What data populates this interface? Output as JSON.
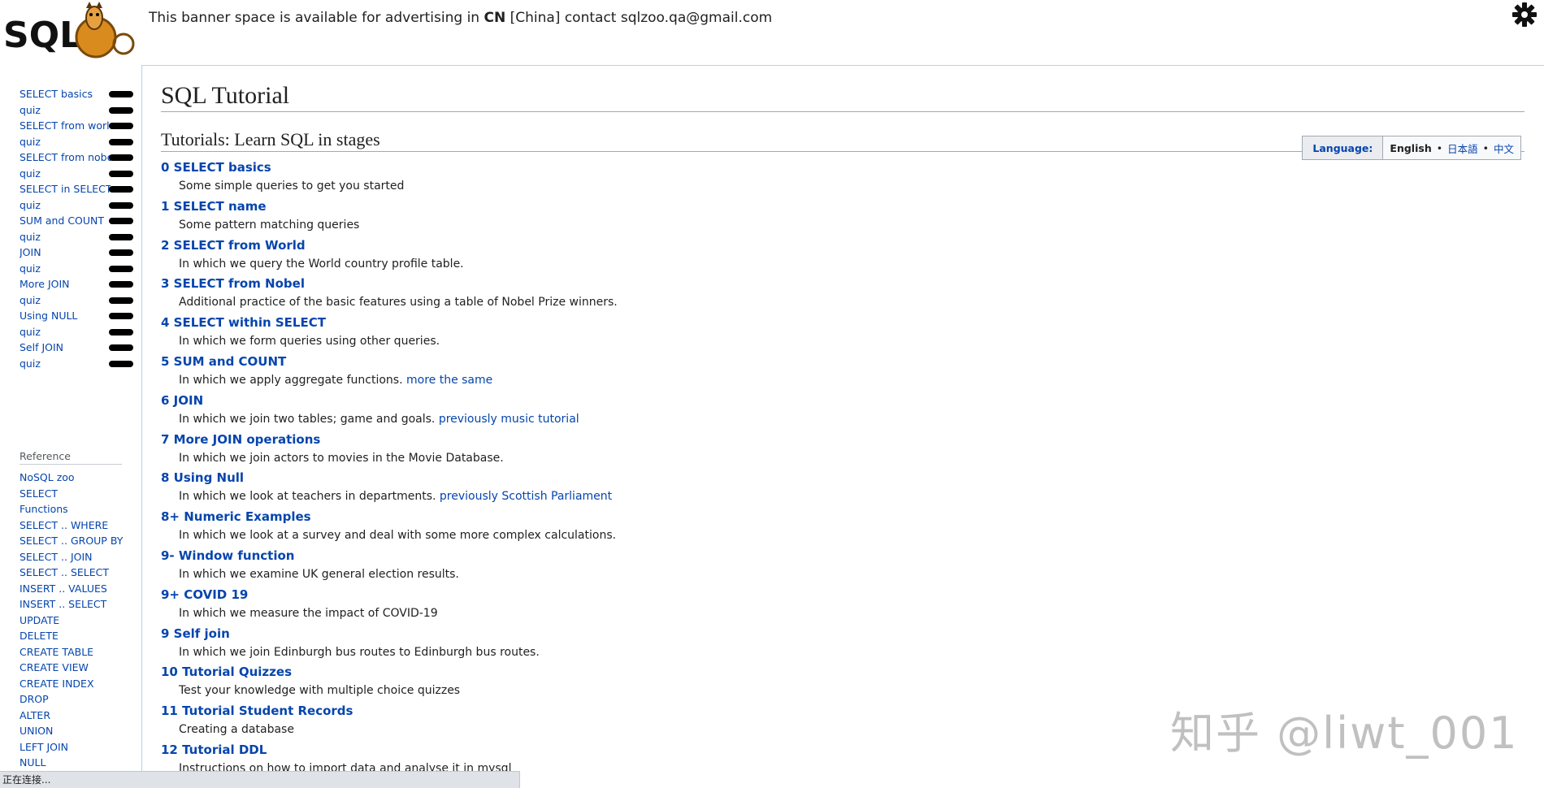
{
  "logo": {
    "text": "SQL"
  },
  "banner": {
    "text_before": "This banner space is available for advertising in ",
    "country_code": "CN",
    "text_after": " [China] contact sqlzoo.qa@gmail.com"
  },
  "icons": {
    "settings": "gear-icon"
  },
  "sidebar": {
    "tutorial_links": [
      "SELECT basics",
      "quiz",
      "SELECT from world",
      "quiz",
      "SELECT from nobel",
      "quiz",
      "SELECT in SELECT",
      "quiz",
      "SUM and COUNT",
      "quiz",
      "JOIN",
      "quiz",
      "More JOIN",
      "quiz",
      "Using NULL",
      "quiz",
      "Self JOIN",
      "quiz"
    ],
    "reference_heading": "Reference",
    "reference_links": [
      "NoSQL zoo",
      "SELECT",
      "Functions",
      "SELECT .. WHERE",
      "SELECT .. GROUP BY",
      "SELECT .. JOIN",
      "SELECT .. SELECT",
      "INSERT .. VALUES",
      "INSERT .. SELECT",
      "UPDATE",
      "DELETE",
      "CREATE TABLE",
      "CREATE VIEW",
      "CREATE INDEX",
      "DROP",
      "ALTER",
      "UNION",
      "LEFT JOIN",
      "NULL"
    ]
  },
  "page": {
    "title": "SQL Tutorial",
    "section_title": "Tutorials: Learn SQL in stages"
  },
  "language": {
    "label": "Language:",
    "current": "English",
    "sep1": "•",
    "option_ja": "日本語",
    "sep2": "•",
    "option_zh": "中文"
  },
  "tutorials": [
    {
      "title": "0 SELECT basics",
      "desc": "Some simple queries to get you started",
      "extra": ""
    },
    {
      "title": "1 SELECT name",
      "desc": "Some pattern matching queries",
      "extra": ""
    },
    {
      "title": "2 SELECT from World",
      "desc": "In which we query the World country profile table.",
      "extra": ""
    },
    {
      "title": "3 SELECT from Nobel",
      "desc": "Additional practice of the basic features using a table of Nobel Prize winners.",
      "extra": ""
    },
    {
      "title": "4 SELECT within SELECT",
      "desc": "In which we form queries using other queries.",
      "extra": ""
    },
    {
      "title": "5 SUM and COUNT",
      "desc": "In which we apply aggregate functions. ",
      "extra": "more the same"
    },
    {
      "title": "6 JOIN",
      "desc": "In which we join two tables; game and goals. ",
      "extra": "previously music tutorial"
    },
    {
      "title": "7 More JOIN operations",
      "desc": "In which we join actors to movies in the Movie Database.",
      "extra": ""
    },
    {
      "title": "8 Using Null",
      "desc": "In which we look at teachers in departments. ",
      "extra": "previously Scottish Parliament"
    },
    {
      "title": "8+ Numeric Examples",
      "desc": "In which we look at a survey and deal with some more complex calculations.",
      "extra": ""
    },
    {
      "title": "9- Window function",
      "desc": "In which we examine UK general election results.",
      "extra": ""
    },
    {
      "title": "9+ COVID 19",
      "desc": "In which we measure the impact of COVID-19",
      "extra": ""
    },
    {
      "title": "9 Self join",
      "desc": "In which we join Edinburgh bus routes to Edinburgh bus routes.",
      "extra": ""
    },
    {
      "title": "10 Tutorial Quizzes",
      "desc": "Test your knowledge with multiple choice quizzes",
      "extra": ""
    },
    {
      "title": "11 Tutorial Student Records",
      "desc": "Creating a database",
      "extra": ""
    },
    {
      "title": "12 Tutorial DDL",
      "desc": "Instructions on how to import data and analyse it in mysql",
      "extra": ""
    }
  ],
  "watermark": "知乎 @liwt_001",
  "status_bar": "正在连接..."
}
